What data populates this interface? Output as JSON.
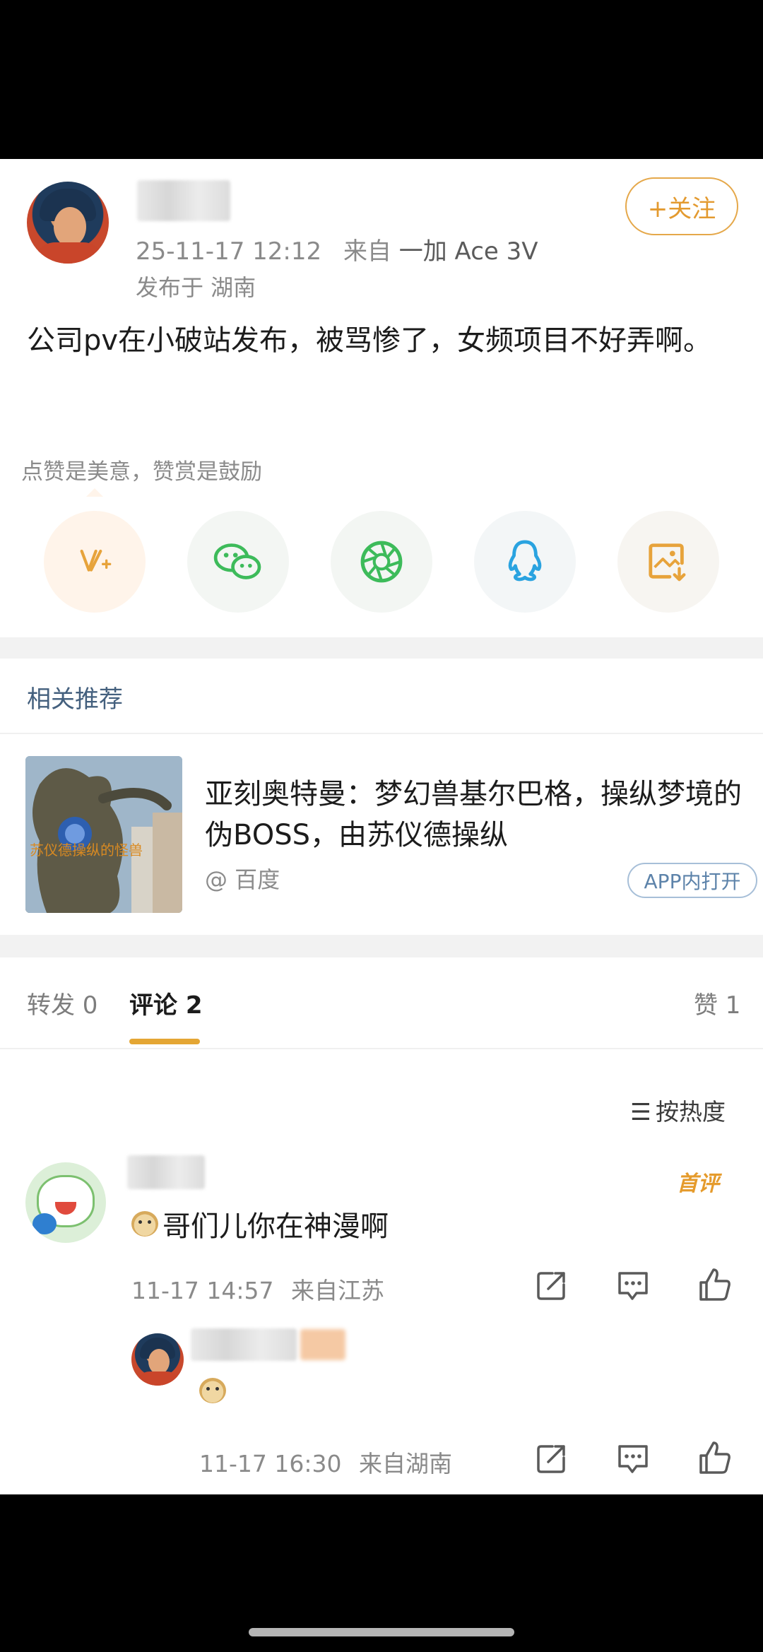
{
  "post": {
    "timestamp": "25-11-17 12:12",
    "source_prefix": "来自",
    "device": "一加 Ace 3V",
    "location": "发布于 湖南",
    "follow_label": "+关注",
    "content": "公司pv在小破站发布，被骂惨了，女频项目不好弄啊。"
  },
  "reward": {
    "text": "点赞是美意，赞赏是鼓励"
  },
  "share": {
    "buttons": [
      {
        "icon": "v-plus-icon",
        "color": "#e7a33b"
      },
      {
        "icon": "wechat-icon",
        "color": "#3dbb5a"
      },
      {
        "icon": "moments-icon",
        "color": "#3dbb5a"
      },
      {
        "icon": "qq-icon",
        "color": "#2aa3e0"
      },
      {
        "icon": "save-image-icon",
        "color": "#e7a33b"
      }
    ]
  },
  "related": {
    "title": "相关推荐",
    "item": {
      "title": "亚刻奥特曼：梦幻兽基尔巴格，操纵梦境的伪BOSS，由苏仪德操纵",
      "source": "@ 百度",
      "open_app": "APP内打开"
    }
  },
  "tabs": {
    "repost": "转发 0",
    "comments": "评论 2",
    "likes": "赞 1"
  },
  "sort": {
    "label": "按热度"
  },
  "comments": [
    {
      "badge": "首评",
      "text": "哥们儿你在神漫啊",
      "time": "11-17 14:57",
      "from": "来自江苏"
    },
    {
      "time": "11-17 16:30",
      "from": "来自湖南"
    }
  ],
  "colors": {
    "accent": "#e5a634",
    "link": "#44607e",
    "meta": "#8a8a8a"
  }
}
